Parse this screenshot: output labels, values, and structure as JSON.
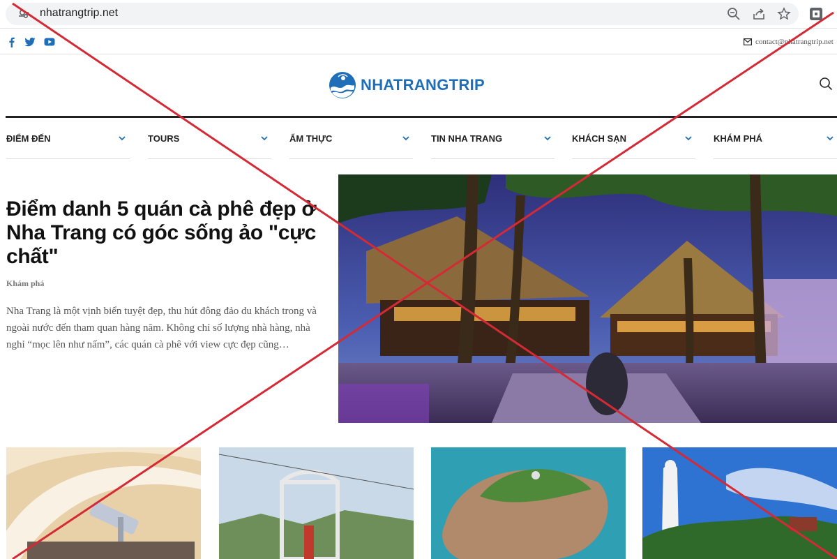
{
  "browser": {
    "url": "nhatrangtrip.net",
    "icons": [
      "lock-icon",
      "zoom-icon",
      "share-icon",
      "bookmark-star-icon",
      "extension-icon"
    ]
  },
  "topbar": {
    "social": [
      "facebook-icon",
      "twitter-icon",
      "youtube-icon"
    ],
    "contact_email": "contact@nhatrangtrip.net"
  },
  "brand": {
    "logo_text": "NHATRANGTRIP",
    "color": "#1f6fb8"
  },
  "nav": {
    "items": [
      {
        "label": "ĐIỂM ĐẾN"
      },
      {
        "label": "TOURS"
      },
      {
        "label": "ẨM THỰC"
      },
      {
        "label": "TIN NHA TRANG"
      },
      {
        "label": "KHÁCH SẠN"
      },
      {
        "label": "KHÁM PHÁ"
      }
    ],
    "accent": "#1f6fb8"
  },
  "hero": {
    "title": "Điểm danh 5 quán cà phê đẹp ở Nha Trang có góc sống ảo \"cực chất\"",
    "category": "Khám phá",
    "excerpt": "Nha Trang là một vịnh biển tuyệt đẹp, thu hút đông đảo du khách trong và ngoài nước đến tham quan hàng năm. Không chỉ số lượng nhà hàng, nhà nghỉ “mọc lên như nấm”, các quán cà phê với view cực đẹp cũng…"
  },
  "overlay": {
    "cross_color": "#d42a36"
  }
}
